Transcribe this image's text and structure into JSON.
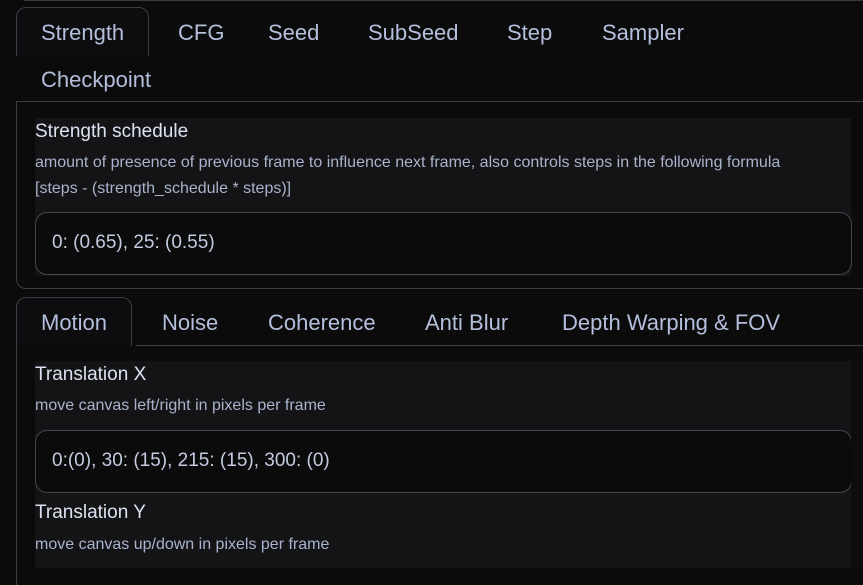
{
  "top_tabs": {
    "items": [
      {
        "label": "Strength",
        "active": true
      },
      {
        "label": "CFG",
        "active": false
      },
      {
        "label": "Seed",
        "active": false
      },
      {
        "label": "SubSeed",
        "active": false
      },
      {
        "label": "Step",
        "active": false
      },
      {
        "label": "Sampler",
        "active": false
      },
      {
        "label": "Checkpoint",
        "active": false
      }
    ]
  },
  "strength_panel": {
    "label": "Strength schedule",
    "info_line1": "amount of presence of previous frame to influence next frame, also controls steps in the following formula",
    "info_line2": "[steps - (strength_schedule * steps)]",
    "value": "0: (0.65), 25: (0.55)"
  },
  "motion_tabs": {
    "items": [
      {
        "label": "Motion",
        "active": true
      },
      {
        "label": "Noise",
        "active": false
      },
      {
        "label": "Coherence",
        "active": false
      },
      {
        "label": "Anti Blur",
        "active": false
      },
      {
        "label": "Depth Warping & FOV",
        "active": false
      }
    ]
  },
  "motion_panel": {
    "translation_x": {
      "label": "Translation X",
      "info": "move canvas left/right in pixels per frame",
      "value": "0:(0), 30: (15), 215: (15), 300: (0)"
    },
    "translation_y": {
      "label": "Translation Y",
      "info": "move canvas up/down in pixels per frame"
    }
  },
  "colors": {
    "background": "#0b0b0c",
    "panel": "#141416",
    "border": "#3d3d45",
    "tab_text": "#b4bfdc",
    "label_text": "#dbe2f2"
  }
}
